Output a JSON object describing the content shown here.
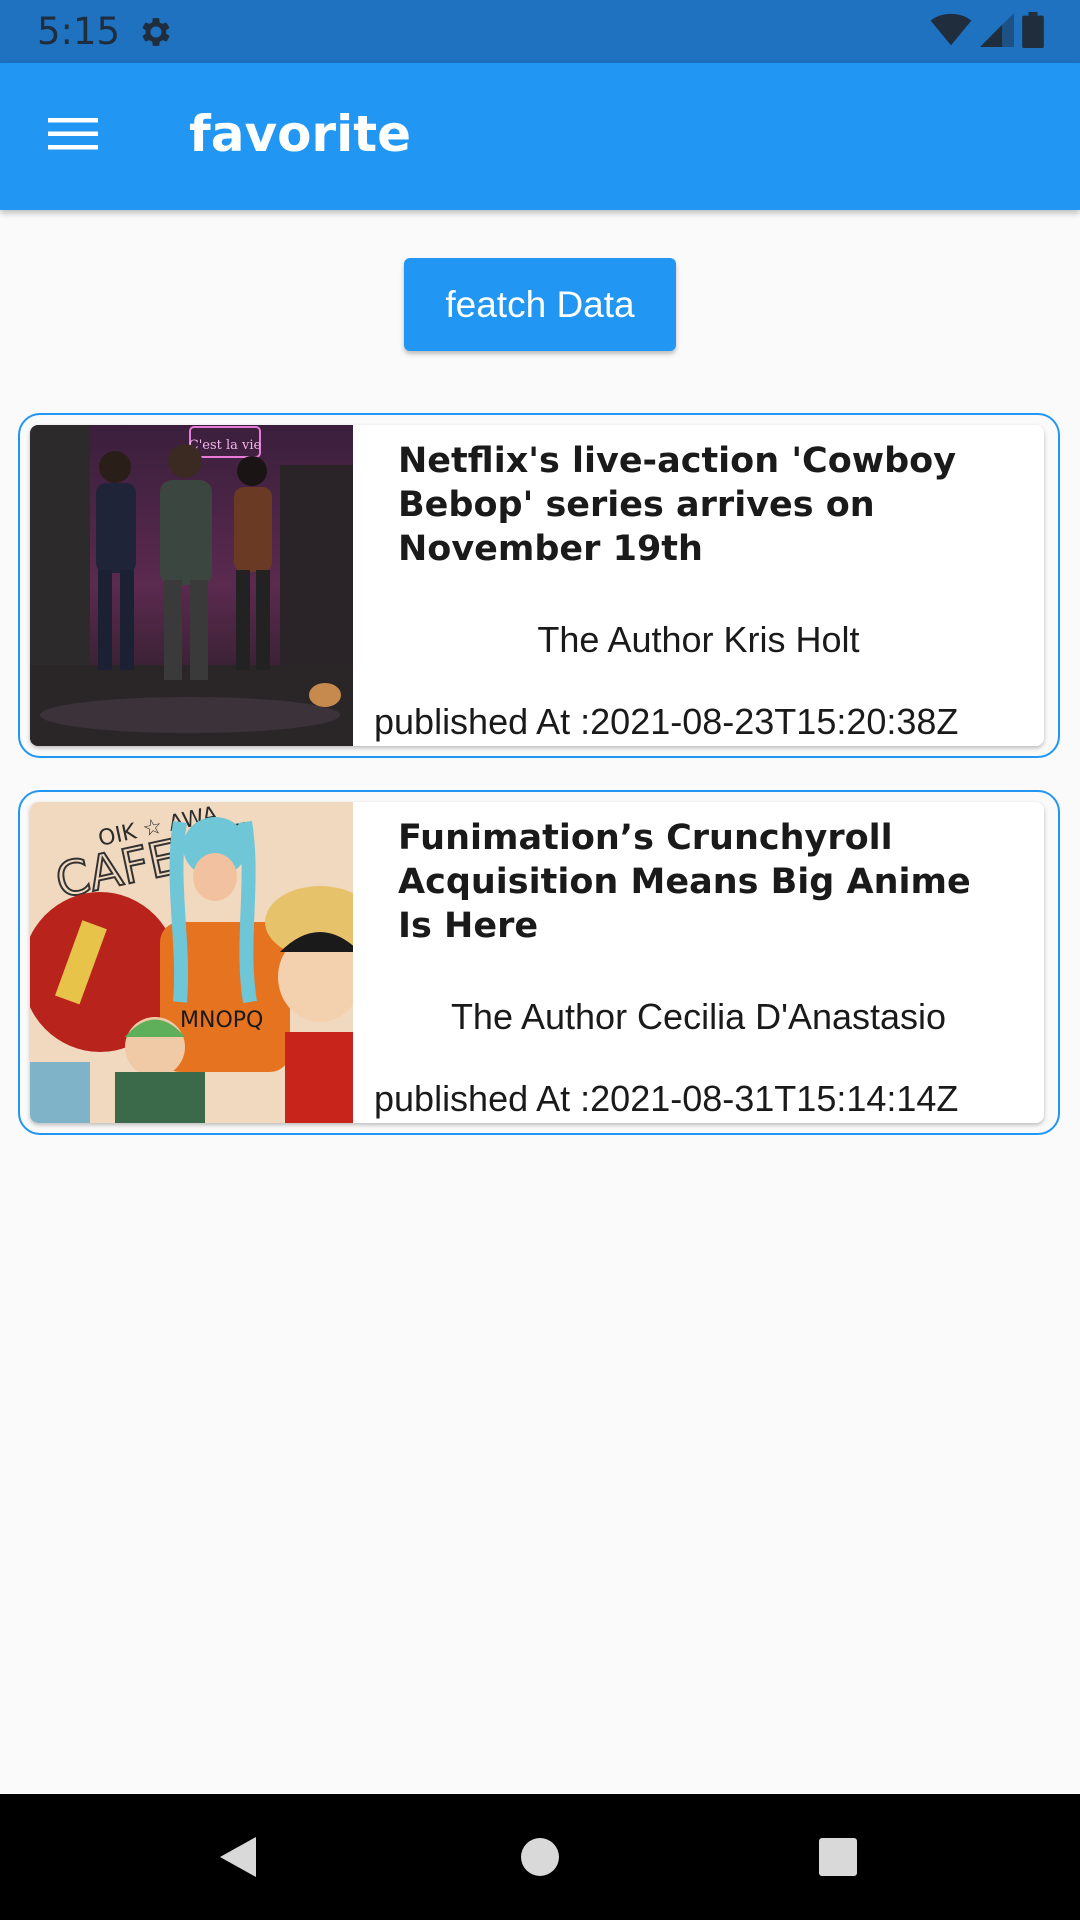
{
  "status_bar": {
    "time": "5:15",
    "icons": [
      "settings-icon",
      "wifi-icon",
      "signal-icon",
      "battery-icon"
    ]
  },
  "app_bar": {
    "title": "favorite",
    "menu_icon": "menu-icon",
    "color": "#2196f3"
  },
  "actions": {
    "fetch_label": "featch Data"
  },
  "articles": [
    {
      "title": "Netflix's live-action 'Cowboy Bebop' series arrives on November 19th",
      "author": "The Author Kris Holt",
      "published": "published At :2021-08-23T15:20:38Z",
      "image_sign": "C'est la vie"
    },
    {
      "title": "Funimation’s Crunchyroll Acquisition Means Big Anime Is Here",
      "author": "The Author Cecilia D'Anastasio",
      "published": "published At :2021-08-31T15:14:14Z",
      "image_sign": "CAFE TE"
    }
  ],
  "nav_bar": {
    "buttons": [
      "back-icon",
      "home-icon",
      "recents-icon"
    ]
  }
}
